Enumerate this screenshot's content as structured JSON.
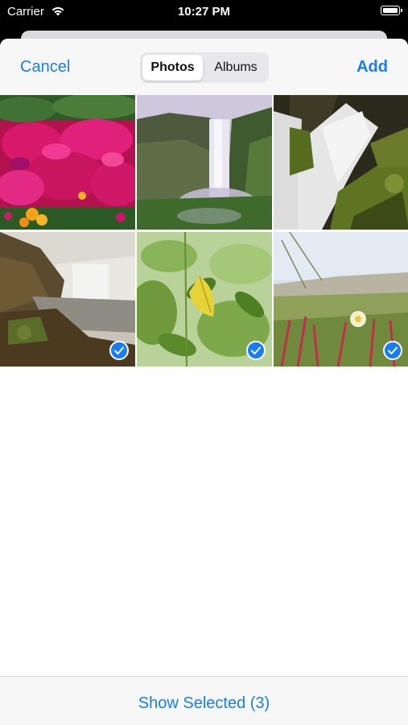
{
  "status_bar": {
    "carrier": "Carrier",
    "time": "10:27 PM"
  },
  "nav": {
    "cancel_label": "Cancel",
    "add_label": "Add",
    "segments": [
      {
        "label": "Photos",
        "selected": true
      },
      {
        "label": "Albums",
        "selected": false
      }
    ]
  },
  "grid": {
    "photos": [
      {
        "subject": "pink flowers with yellow flowers",
        "selected": false
      },
      {
        "subject": "waterfall over green cliff",
        "selected": false
      },
      {
        "subject": "waterfall close-up with mossy rocks",
        "selected": false
      },
      {
        "subject": "waterfall in misty canyon",
        "selected": true
      },
      {
        "subject": "green leaves with yellow leaf",
        "selected": true
      },
      {
        "subject": "white flower in grass",
        "selected": true
      }
    ]
  },
  "toolbar": {
    "show_selected_label": "Show Selected (3)"
  },
  "colors": {
    "accent": "#1a7cf4",
    "check_blue": "#1a7cf4"
  }
}
